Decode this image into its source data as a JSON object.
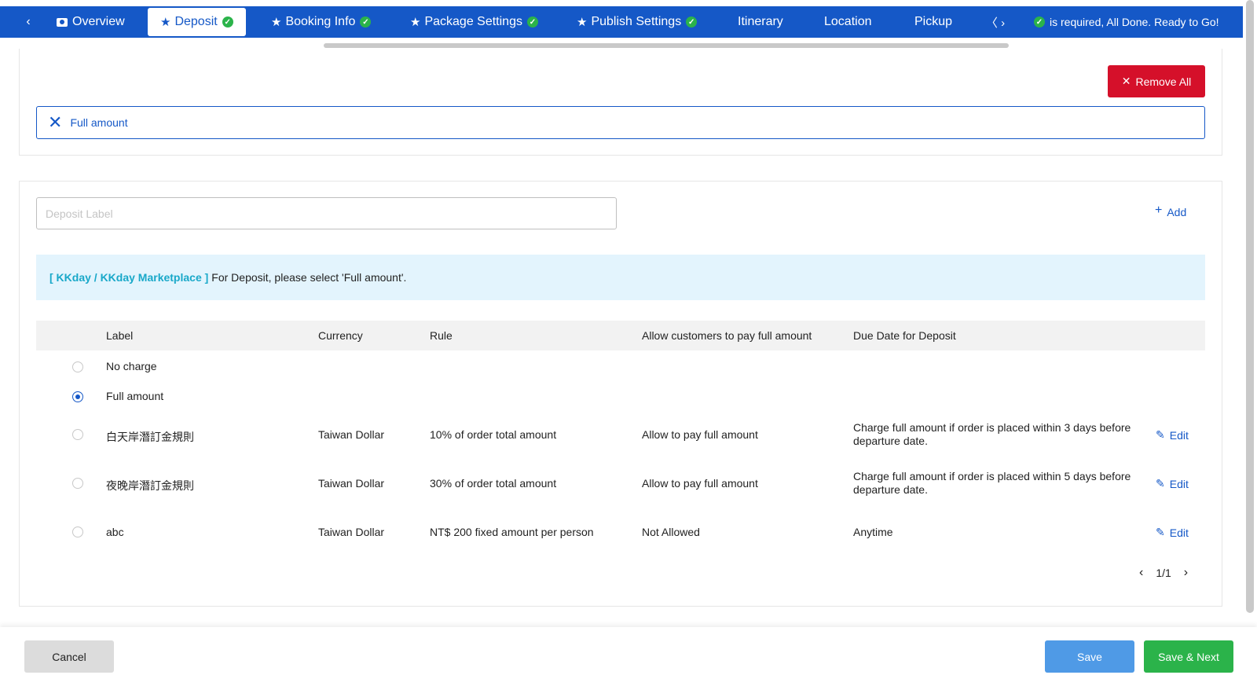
{
  "nav": {
    "left_arrow": "‹",
    "right_arrows": "〈 ›",
    "tabs": [
      {
        "label": "Overview"
      },
      {
        "label": "Deposit"
      },
      {
        "label": "Booking Info"
      },
      {
        "label": "Package Settings"
      },
      {
        "label": "Publish Settings"
      },
      {
        "label": "Itinerary"
      },
      {
        "label": "Location"
      },
      {
        "label": "Pickup"
      }
    ],
    "status_text": "is required,  All Done. Ready to Go!"
  },
  "selection": {
    "remove_all_label": "Remove All",
    "selected_value": "Full amount"
  },
  "form": {
    "deposit_label_placeholder": "Deposit Label",
    "add_label": "Add"
  },
  "info": {
    "tag": "[ KKday / KKday Marketplace ]",
    "text": "For Deposit, please select 'Full amount'."
  },
  "table": {
    "headers": {
      "label": "Label",
      "currency": "Currency",
      "rule": "Rule",
      "allow_full": "Allow customers to pay full amount",
      "due_date": "Due Date for Deposit"
    },
    "rows": [
      {
        "label": "No charge",
        "currency": "",
        "rule": "",
        "allow_full": "",
        "due_date": "",
        "selected": false,
        "editable": false
      },
      {
        "label": "Full amount",
        "currency": "",
        "rule": "",
        "allow_full": "",
        "due_date": "",
        "selected": true,
        "editable": false
      },
      {
        "label": "白天岸潛訂金規則",
        "currency": "Taiwan Dollar",
        "rule": "10% of order total amount",
        "allow_full": "Allow to pay full amount",
        "due_date": "Charge full amount if order is placed within 3 days before departure date.",
        "selected": false,
        "editable": true
      },
      {
        "label": "夜晚岸潛訂金規則",
        "currency": "Taiwan Dollar",
        "rule": "30% of order total amount",
        "allow_full": "Allow to pay full amount",
        "due_date": "Charge full amount if order is placed within 5 days before departure date.",
        "selected": false,
        "editable": true
      },
      {
        "label": "abc",
        "currency": "Taiwan Dollar",
        "rule": "NT$ 200 fixed amount per person",
        "allow_full": "Not Allowed",
        "due_date": "Anytime",
        "selected": false,
        "editable": true
      }
    ],
    "edit_label": "Edit",
    "pagination": "1/1"
  },
  "footer": {
    "cancel_label": "Cancel",
    "save_label": "Save",
    "save_next_label": "Save & Next"
  },
  "colors": {
    "nav_bg": "#1558c7",
    "danger": "#d5102a",
    "success": "#2bb34a",
    "info_bg": "#e3f4fd",
    "save": "#4f9ae6"
  }
}
